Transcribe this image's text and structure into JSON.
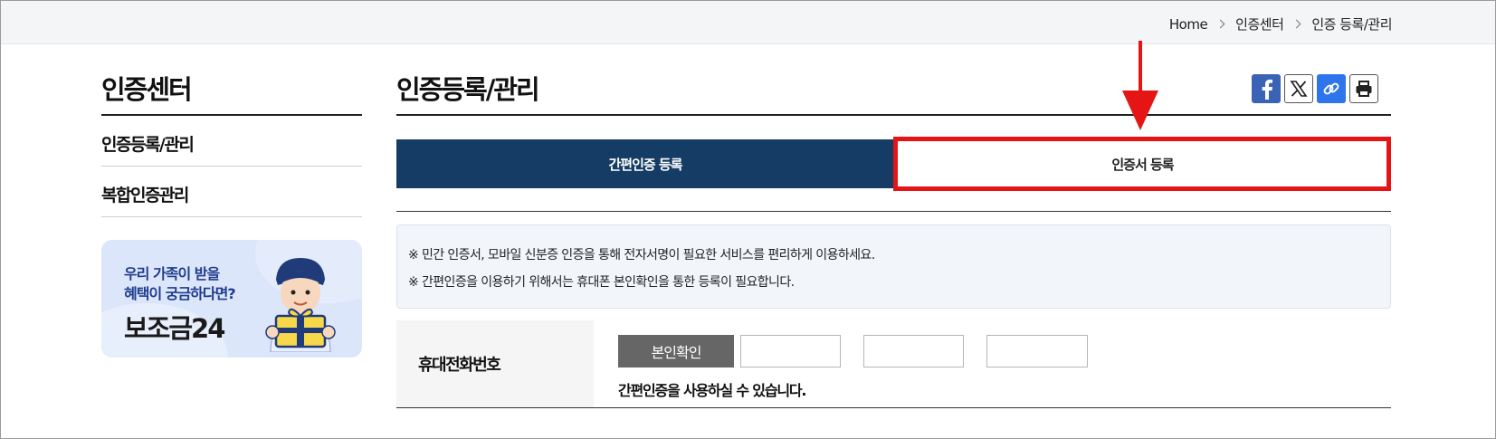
{
  "breadcrumb": {
    "home": "Home",
    "level1": "인증센터",
    "level2": "인증 등록/관리"
  },
  "sidebar": {
    "title": "인증센터",
    "items": [
      {
        "label": "인증등록/관리"
      },
      {
        "label": "복합인증관리"
      }
    ],
    "banner": {
      "line1": "우리 가족이 받을",
      "line2": "혜택이 궁금하다면?",
      "line3": "보조금24"
    }
  },
  "main": {
    "title": "인증등록/관리",
    "share_icons": [
      "facebook-icon",
      "x-icon",
      "link-icon",
      "print-icon"
    ],
    "tabs": [
      {
        "label": "간편인증 등록",
        "active": true
      },
      {
        "label": "인증서 등록",
        "active": false
      }
    ],
    "notice": [
      "※ 민간 인증서, 모바일 신분증 인증을 통해 전자서명이 필요한 서비스를 편리하게 이용하세요.",
      "※ 간편인증을 이용하기 위해서는 휴대폰 본인확인을 통한 등록이 필요합니다."
    ],
    "phone_row": {
      "label": "휴대전화번호",
      "verify_button": "본인확인",
      "inputs": [
        "",
        "",
        ""
      ],
      "status": "간편인증을 사용하실 수 있습니다."
    }
  },
  "colors": {
    "tab_active_bg": "#143c64",
    "highlight": "#e51515",
    "facebook": "#3b63b5",
    "link": "#2e74ea"
  }
}
